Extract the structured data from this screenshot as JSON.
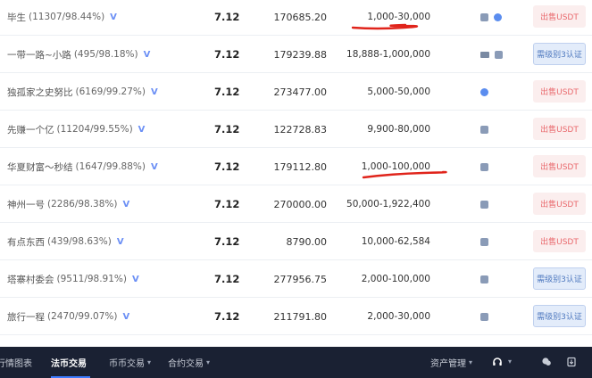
{
  "rows": [
    {
      "name": "毕生",
      "meta": "(11307/98.44%)",
      "badge": "V",
      "price": "7.12",
      "amount": "170685.20",
      "limit": "1,000-30,000",
      "icons": [
        "bank-icon",
        "message-icon"
      ],
      "action": "出售USDT",
      "action_type": "sell",
      "highlight": true
    },
    {
      "name": "一带一路~小路",
      "meta": "(495/98.18%)",
      "badge": "V",
      "price": "7.12",
      "amount": "179239.88",
      "limit": "18,888-1,000,000",
      "icons": [
        "card-icon",
        "bank-icon"
      ],
      "action": "需级别3认证",
      "action_type": "verify",
      "highlight": false
    },
    {
      "name": "独孤家之史努比",
      "meta": "(6169/99.27%)",
      "badge": "V",
      "price": "7.12",
      "amount": "273477.00",
      "limit": "5,000-50,000",
      "icons": [
        "message-icon"
      ],
      "action": "出售USDT",
      "action_type": "sell",
      "highlight": false
    },
    {
      "name": "先赚一个亿",
      "meta": "(11204/99.55%)",
      "badge": "V",
      "price": "7.12",
      "amount": "122728.83",
      "limit": "9,900-80,000",
      "icons": [
        "bank-icon"
      ],
      "action": "出售USDT",
      "action_type": "sell",
      "highlight": false
    },
    {
      "name": "华夏财富～秒结",
      "meta": "(1647/99.88%)",
      "badge": "V",
      "price": "7.12",
      "amount": "179112.80",
      "limit": "1,000-100,000",
      "icons": [
        "bank-icon"
      ],
      "action": "出售USDT",
      "action_type": "sell",
      "highlight": true
    },
    {
      "name": "神州一号",
      "meta": "(2286/98.38%)",
      "badge": "V",
      "price": "7.12",
      "amount": "270000.00",
      "limit": "50,000-1,922,400",
      "icons": [
        "bank-icon"
      ],
      "action": "出售USDT",
      "action_type": "sell",
      "highlight": false
    },
    {
      "name": "有点东西",
      "meta": "(439/98.63%)",
      "badge": "V",
      "price": "7.12",
      "amount": "8790.00",
      "limit": "10,000-62,584",
      "icons": [
        "bank-icon"
      ],
      "action": "出售USDT",
      "action_type": "sell",
      "highlight": false
    },
    {
      "name": "塔寨村委会",
      "meta": "(9511/98.91%)",
      "badge": "V",
      "price": "7.12",
      "amount": "277956.75",
      "limit": "2,000-100,000",
      "icons": [
        "bank-icon"
      ],
      "action": "需级别3认证",
      "action_type": "verify",
      "highlight": false
    },
    {
      "name": "旅行一程",
      "meta": "(2470/99.07%)",
      "badge": "V",
      "price": "7.12",
      "amount": "211791.80",
      "limit": "2,000-30,000",
      "icons": [
        "bank-icon"
      ],
      "action": "需级别3认证",
      "action_type": "verify",
      "highlight": false
    }
  ],
  "nav": {
    "items": [
      {
        "label": "行情图表",
        "active": false,
        "chevron": false
      },
      {
        "label": "法币交易",
        "active": true,
        "chevron": false
      },
      {
        "label": "币币交易",
        "active": false,
        "chevron": true
      },
      {
        "label": "合约交易",
        "active": false,
        "chevron": true
      }
    ],
    "asset": "资产管理",
    "icons": [
      "headset-icon",
      "chat-icon",
      "download-icon"
    ]
  },
  "colors": {
    "sell_bg": "#fbeeee",
    "sell_text": "#e9686c",
    "verify_bg": "#e3ecfa",
    "verify_text": "#4f79bf",
    "nav_bg": "#1a2133",
    "accent": "#3d7bff",
    "annotation": "#e0241b"
  }
}
